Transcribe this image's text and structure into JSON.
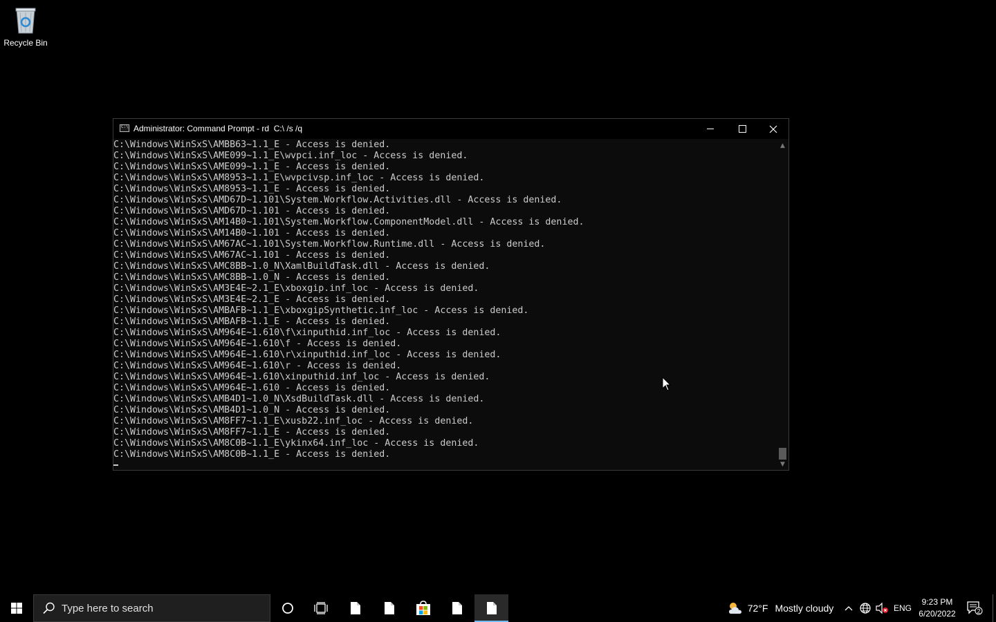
{
  "desktop": {
    "recycle_bin_label": "Recycle Bin"
  },
  "window": {
    "title": "Administrator: Command Prompt - rd  C:\\ /s /q",
    "lines": [
      "C:\\Windows\\WinSxS\\AMBB63~1.1_E - Access is denied.",
      "C:\\Windows\\WinSxS\\AME099~1.1_E\\wvpci.inf_loc - Access is denied.",
      "C:\\Windows\\WinSxS\\AME099~1.1_E - Access is denied.",
      "C:\\Windows\\WinSxS\\AM8953~1.1_E\\wvpcivsp.inf_loc - Access is denied.",
      "C:\\Windows\\WinSxS\\AM8953~1.1_E - Access is denied.",
      "C:\\Windows\\WinSxS\\AMD67D~1.101\\System.Workflow.Activities.dll - Access is denied.",
      "C:\\Windows\\WinSxS\\AMD67D~1.101 - Access is denied.",
      "C:\\Windows\\WinSxS\\AM14B0~1.101\\System.Workflow.ComponentModel.dll - Access is denied.",
      "C:\\Windows\\WinSxS\\AM14B0~1.101 - Access is denied.",
      "C:\\Windows\\WinSxS\\AM67AC~1.101\\System.Workflow.Runtime.dll - Access is denied.",
      "C:\\Windows\\WinSxS\\AM67AC~1.101 - Access is denied.",
      "C:\\Windows\\WinSxS\\AMC8BB~1.0_N\\XamlBuildTask.dll - Access is denied.",
      "C:\\Windows\\WinSxS\\AMC8BB~1.0_N - Access is denied.",
      "C:\\Windows\\WinSxS\\AM3E4E~2.1_E\\xboxgip.inf_loc - Access is denied.",
      "C:\\Windows\\WinSxS\\AM3E4E~2.1_E - Access is denied.",
      "C:\\Windows\\WinSxS\\AMBAFB~1.1_E\\xboxgipSynthetic.inf_loc - Access is denied.",
      "C:\\Windows\\WinSxS\\AMBAFB~1.1_E - Access is denied.",
      "C:\\Windows\\WinSxS\\AM964E~1.610\\f\\xinputhid.inf_loc - Access is denied.",
      "C:\\Windows\\WinSxS\\AM964E~1.610\\f - Access is denied.",
      "C:\\Windows\\WinSxS\\AM964E~1.610\\r\\xinputhid.inf_loc - Access is denied.",
      "C:\\Windows\\WinSxS\\AM964E~1.610\\r - Access is denied.",
      "C:\\Windows\\WinSxS\\AM964E~1.610\\xinputhid.inf_loc - Access is denied.",
      "C:\\Windows\\WinSxS\\AM964E~1.610 - Access is denied.",
      "C:\\Windows\\WinSxS\\AMB4D1~1.0_N\\XsdBuildTask.dll - Access is denied.",
      "C:\\Windows\\WinSxS\\AMB4D1~1.0_N - Access is denied.",
      "C:\\Windows\\WinSxS\\AM8FF7~1.1_E\\xusb22.inf_loc - Access is denied.",
      "C:\\Windows\\WinSxS\\AM8FF7~1.1_E - Access is denied.",
      "C:\\Windows\\WinSxS\\AM8C0B~1.1_E\\ykinx64.inf_loc - Access is denied.",
      "C:\\Windows\\WinSxS\\AM8C0B~1.1_E - Access is denied."
    ]
  },
  "taskbar": {
    "search_placeholder": "Type here to search",
    "weather_temp": "72°F",
    "weather_condition": "Mostly cloudy",
    "language": "ENG",
    "time": "9:23 PM",
    "date": "6/20/2022",
    "notification_count": "2"
  },
  "colors": {
    "console_bg": "#0c0c0c",
    "console_text": "#cccccc",
    "taskbar_bg": "#000000",
    "active_indicator": "#76b9ed"
  }
}
